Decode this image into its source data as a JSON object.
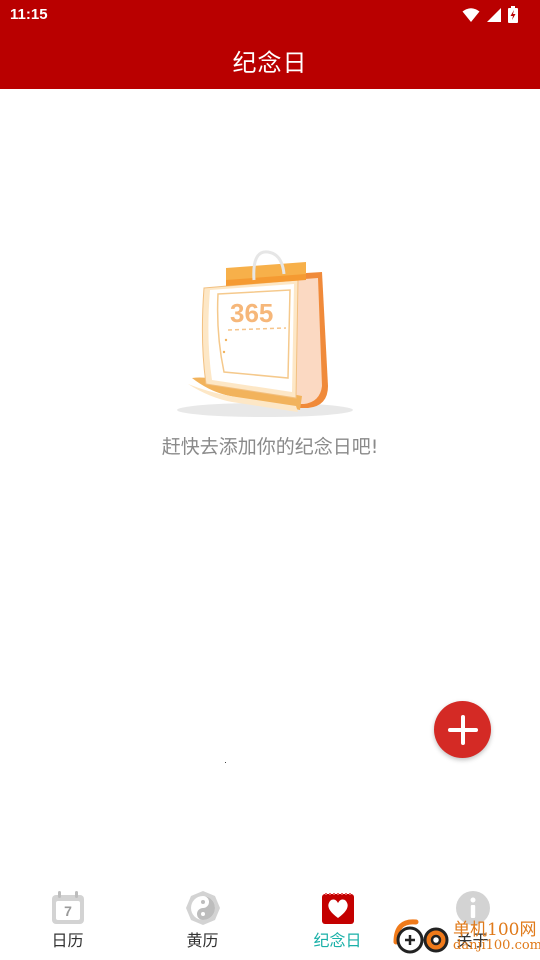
{
  "status_bar": {
    "time": "11:15",
    "icons": [
      "wifi-icon",
      "signal-icon",
      "battery-charging-icon"
    ]
  },
  "app_bar": {
    "title": "纪念日"
  },
  "empty_state": {
    "calendar_number": "365",
    "message": "赶快去添加你的纪念日吧!"
  },
  "fab": {
    "icon": "plus-icon",
    "color": "#d42a25"
  },
  "bottom_nav": {
    "active_color": "#1ab0a8",
    "items": [
      {
        "label": "日历",
        "icon": "calendar-icon",
        "day": "7"
      },
      {
        "label": "黄历",
        "icon": "yin-yang-icon"
      },
      {
        "label": "纪念日",
        "icon": "heart-calendar-icon"
      },
      {
        "label": "关于",
        "icon": "info-icon"
      }
    ]
  },
  "watermark": {
    "line1": "单机100网",
    "line2": "danji100.com"
  },
  "colors": {
    "primary": "#b90000",
    "text_muted": "#8a8a8a"
  }
}
